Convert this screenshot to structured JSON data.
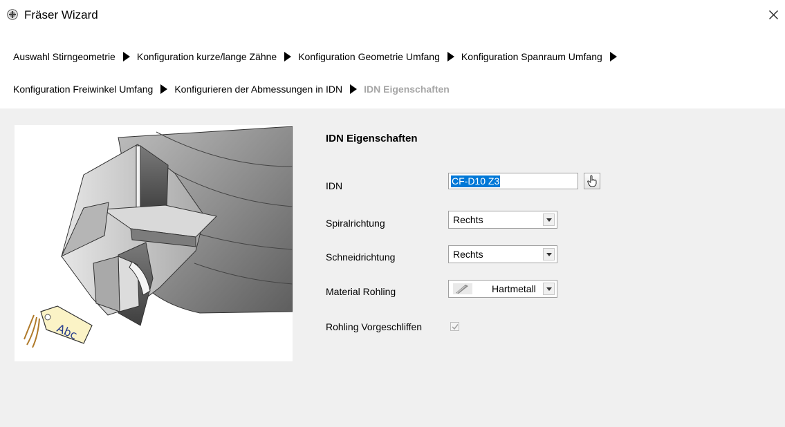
{
  "window": {
    "title": "Fräser Wizard",
    "close_label": "×"
  },
  "breadcrumb": {
    "row1": [
      {
        "label": "Auswahl Stirngeometrie"
      },
      {
        "label": "Konfiguration kurze/lange Zähne"
      },
      {
        "label": "Konfiguration Geometrie Umfang"
      },
      {
        "label": "Konfiguration Spanraum Umfang"
      }
    ],
    "row2": [
      {
        "label": "Konfiguration Freiwinkel Umfang"
      },
      {
        "label": "Konfigurieren der Abmessungen in IDN"
      },
      {
        "label": "IDN Eigenschaften",
        "current": true
      }
    ]
  },
  "preview": {
    "tag_text": "Abc"
  },
  "form": {
    "section_title": "IDN Eigenschaften",
    "idn": {
      "label": "IDN",
      "value": "CF-D10 Z3"
    },
    "spiral": {
      "label": "Spiralrichtung",
      "value": "Rechts"
    },
    "cut": {
      "label": "Schneidrichtung",
      "value": "Rechts"
    },
    "material": {
      "label": "Material Rohling",
      "value": "Hartmetall"
    },
    "pre_ground": {
      "label": "Rohling Vorgeschliffen",
      "checked": true
    }
  },
  "colors": {
    "panel_bg": "#f0f0f0",
    "selection": "#0078d7",
    "current_step": "#a6a6a6"
  }
}
